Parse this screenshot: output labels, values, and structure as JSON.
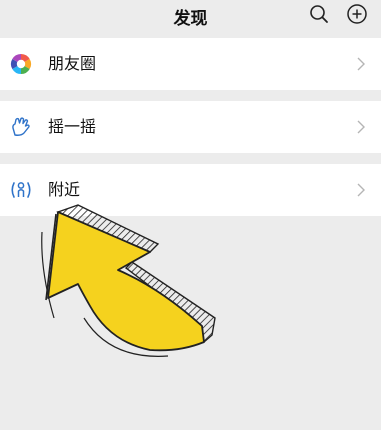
{
  "header": {
    "title": "发现"
  },
  "icons": {
    "search": "search-icon",
    "add": "plus-circle-icon",
    "moments": "moments-aperture-icon",
    "shake": "shake-hand-icon",
    "nearby": "nearby-person-icon",
    "chevron": "chevron-right-icon"
  },
  "rows": [
    {
      "label": "朋友圈"
    },
    {
      "label": "摇一摇"
    },
    {
      "label": "附近"
    }
  ],
  "colors": {
    "background": "#ececec",
    "row": "#ffffff",
    "arrow_fill": "#f5d21e",
    "arrow_outline": "#222222"
  }
}
